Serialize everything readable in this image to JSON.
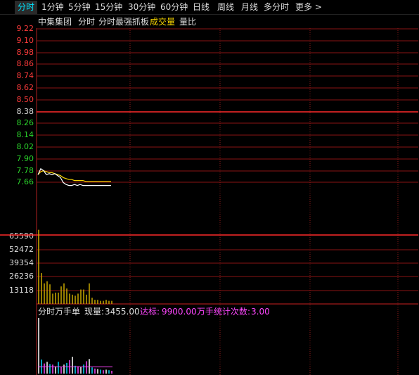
{
  "tabs": [
    {
      "label": "分时",
      "active": true
    },
    {
      "label": "1分钟"
    },
    {
      "label": "5分钟"
    },
    {
      "label": "15分钟"
    },
    {
      "label": "30分钟"
    },
    {
      "label": "60分钟"
    },
    {
      "label": "日线"
    },
    {
      "label": "周线"
    },
    {
      "label": "月线"
    },
    {
      "label": "多分时"
    },
    {
      "label": "更多 >"
    }
  ],
  "header": {
    "stock_name": "中集集团",
    "chart_mode": "分时",
    "indicator": "分时最强抓板",
    "volume_label": "成交量",
    "ratio_label": "量比"
  },
  "price_axis": {
    "labels": [
      "9.22",
      "9.10",
      "8.98",
      "8.86",
      "8.74",
      "8.62",
      "8.50",
      "8.38",
      "8.26",
      "8.14",
      "8.02",
      "7.90",
      "7.78",
      "7.66"
    ],
    "prev_close": "8.38",
    "colors": {
      "up": "#ff3b3b",
      "mid": "#dddddd",
      "down": "#2bd42b"
    }
  },
  "volume_axis": {
    "labels": [
      "65590",
      "52472",
      "39354",
      "26236",
      "13118"
    ]
  },
  "price_series": {
    "price": [
      7.74,
      7.8,
      7.78,
      7.74,
      7.75,
      7.74,
      7.75,
      7.73,
      7.71,
      7.66,
      7.64,
      7.63,
      7.63,
      7.64,
      7.63,
      7.64,
      7.63,
      7.63,
      7.63,
      7.63,
      7.63,
      7.63,
      7.63,
      7.63,
      7.63,
      7.63,
      7.63
    ],
    "avg": [
      7.74,
      7.77,
      7.78,
      7.77,
      7.76,
      7.76,
      7.75,
      7.74,
      7.73,
      7.71,
      7.7,
      7.69,
      7.69,
      7.68,
      7.68,
      7.68,
      7.68,
      7.67,
      7.67,
      7.67,
      7.67,
      7.67,
      7.67,
      7.67,
      7.67,
      7.67,
      7.67
    ]
  },
  "volume_series": [
    72000,
    30000,
    20000,
    22000,
    19000,
    10000,
    11000,
    11000,
    17000,
    20000,
    15000,
    10000,
    9000,
    8000,
    10000,
    14000,
    14000,
    9000,
    20000,
    6000,
    4000,
    4000,
    3000,
    3000,
    4000,
    3000,
    3000
  ],
  "wanshou": {
    "title": "分时万手单",
    "current_label": "现量:",
    "current_value": "3455.00",
    "target_label": "达标:",
    "target_value": "9900.00",
    "count_label": "万手统计次数:",
    "count_value": "3.00",
    "bars": [
      9900,
      2500,
      1800,
      2100,
      1700,
      1600,
      1300,
      2100,
      1200,
      1600,
      1900,
      2400,
      3000,
      1400,
      1300,
      1200,
      1600,
      2200,
      2600,
      1100,
      900,
      800,
      700,
      600,
      700,
      600,
      500
    ],
    "threshold_ratio": 0.12
  }
}
